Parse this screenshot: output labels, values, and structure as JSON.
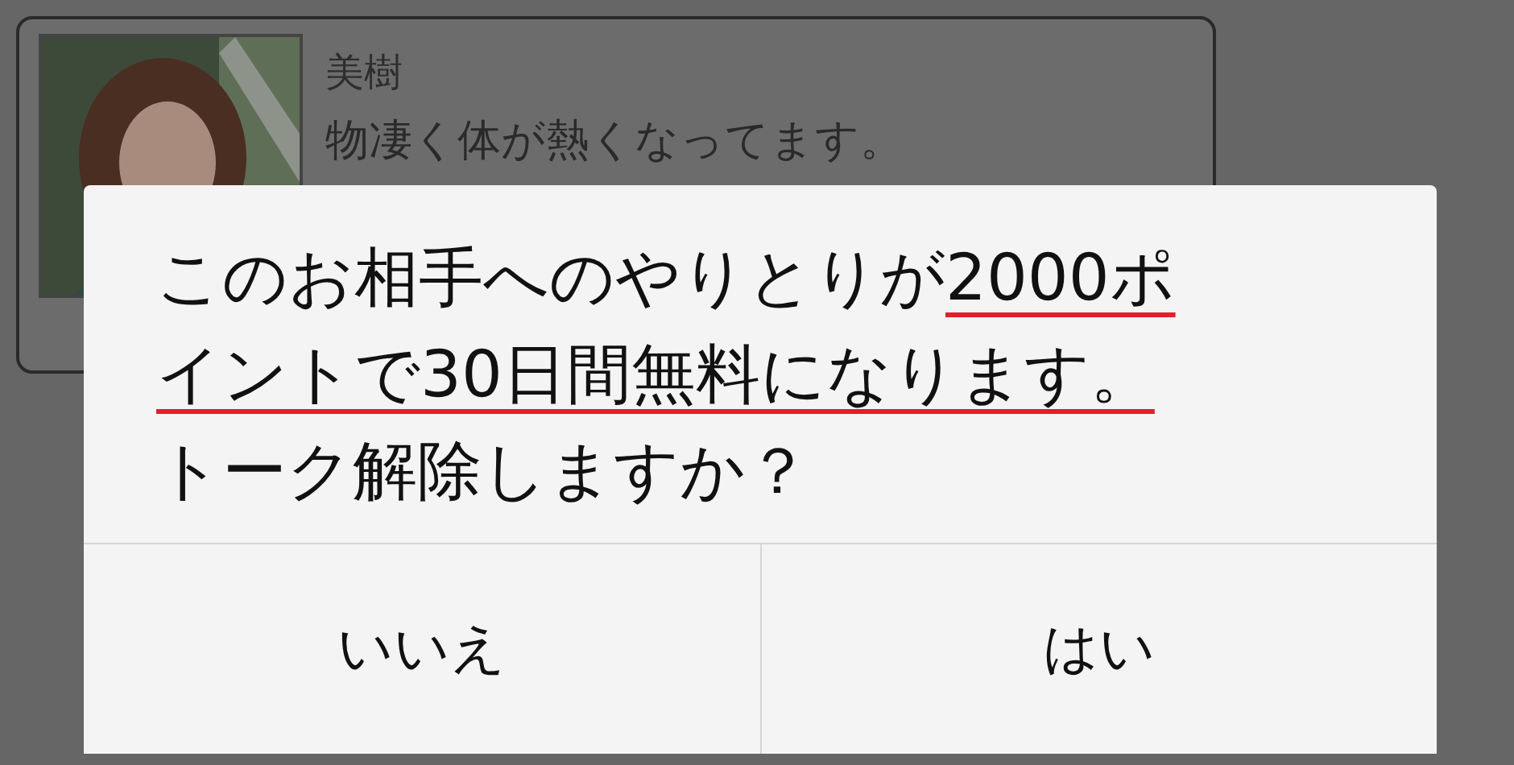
{
  "chat": {
    "sender": "美樹",
    "message": "物凄く体が熱くなってます。"
  },
  "dialog": {
    "message_lines": [
      [
        {
          "text": "このお相手へのやりとりが",
          "underlined": false
        },
        {
          "text": "2000ポ",
          "underlined": true
        }
      ],
      [
        {
          "text": "イントで30日間無料になります。",
          "underlined": true
        }
      ],
      [
        {
          "text": "トーク解除しますか？",
          "underlined": false
        }
      ]
    ],
    "buttons": [
      "いいえ",
      "はい"
    ]
  }
}
